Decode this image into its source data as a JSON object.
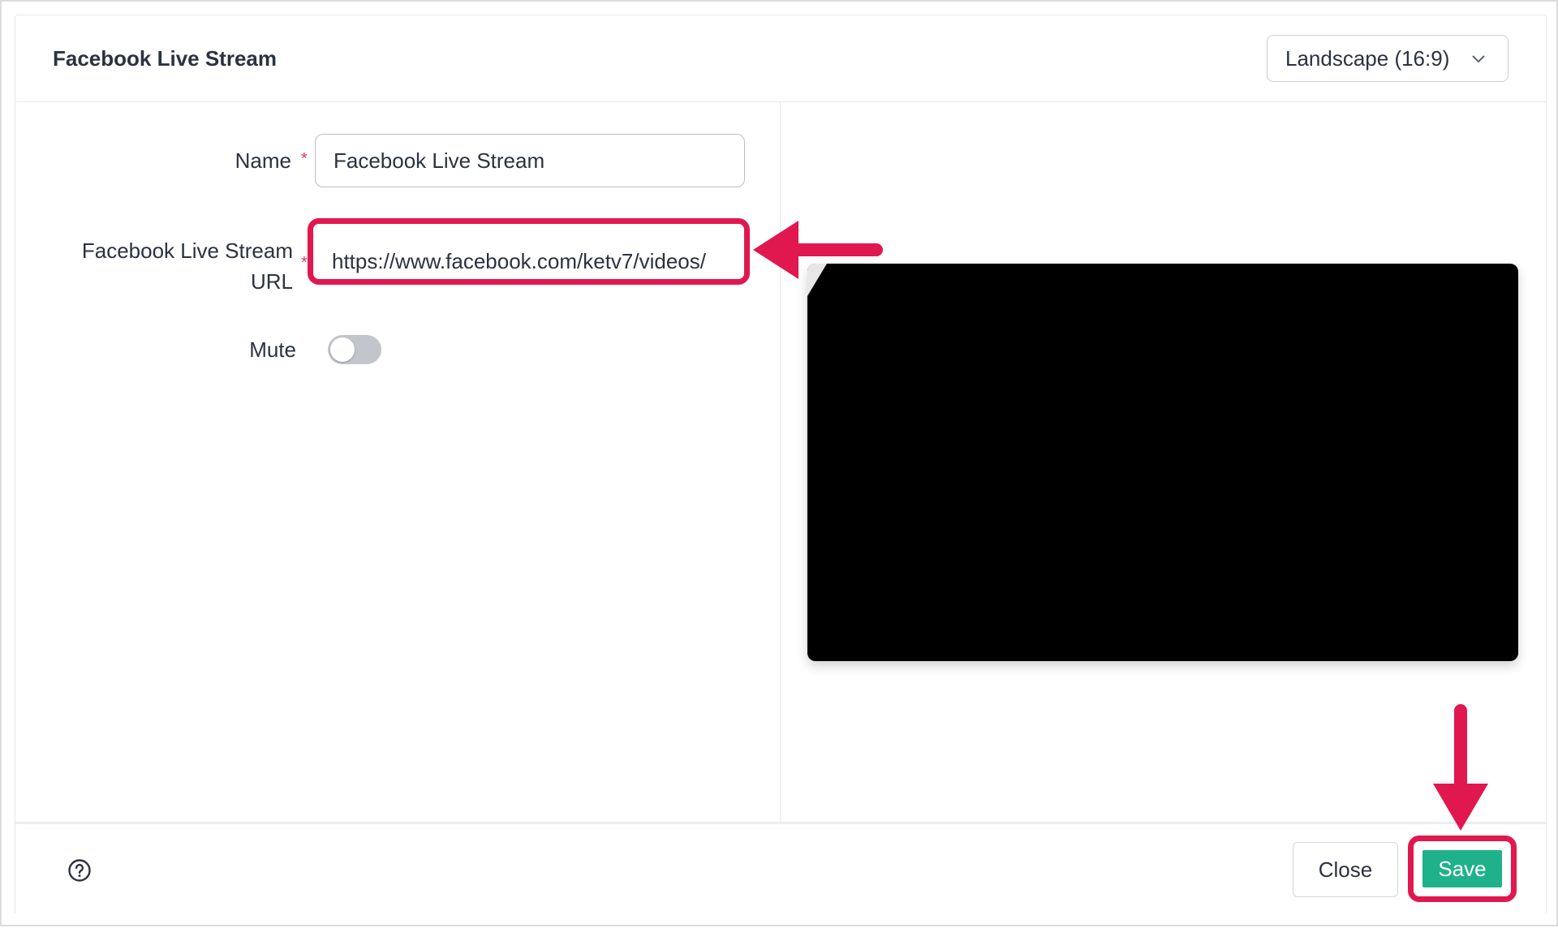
{
  "dialog": {
    "title": "Facebook Live Stream",
    "orientation_select": {
      "value": "Landscape (16:9)",
      "icon": "chevron-down-icon"
    }
  },
  "form": {
    "name": {
      "label": "Name",
      "required_marker": "*",
      "value": "Facebook Live Stream"
    },
    "url": {
      "label_line1": "Facebook Live Stream",
      "label_line2": "URL",
      "required_marker": "*",
      "value": "https://www.facebook.com/ketv7/videos/"
    },
    "mute": {
      "label": "Mute",
      "on": false
    }
  },
  "footer": {
    "help_icon": "help-circle-icon",
    "close_label": "Close",
    "save_label": "Save"
  },
  "colors": {
    "annotation": "#e0184f",
    "save_button": "#1fb28a",
    "required": "#e0365a"
  }
}
